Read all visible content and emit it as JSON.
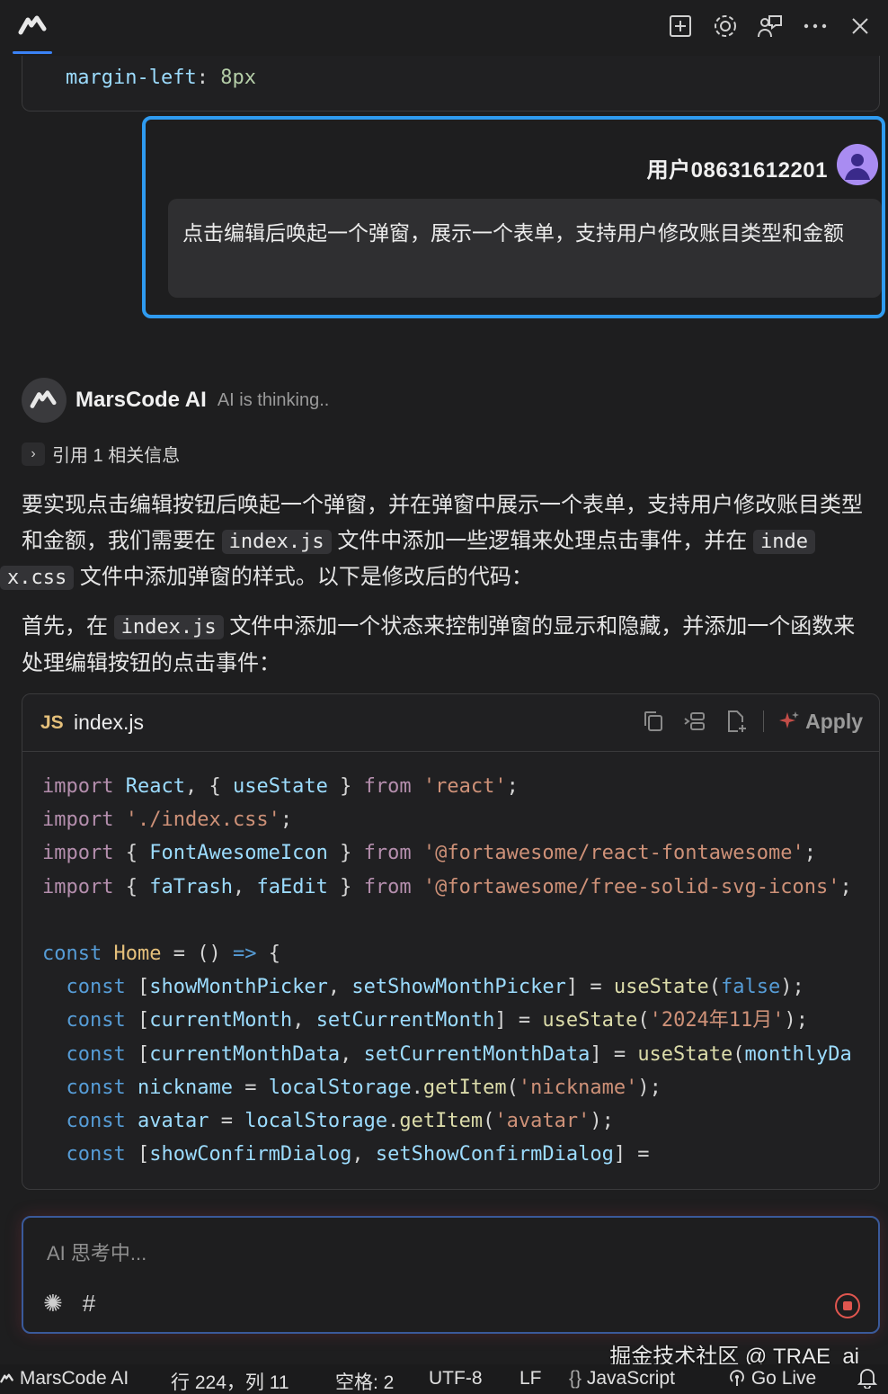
{
  "header": {
    "icons": [
      "new-chat-icon",
      "gear-icon",
      "feedback-icon",
      "more-icon",
      "close-icon"
    ]
  },
  "previous_code": {
    "property": "margin-left",
    "colon": ":",
    "value": "8px"
  },
  "user_message": {
    "username": "用户08631612201",
    "text": "点击编辑后唤起一个弹窗，展示一个表单，支持用户修改账目类型和金额"
  },
  "ai": {
    "name": "MarsCode AI",
    "status": "AI is thinking..",
    "reference": "引用 1 相关信息",
    "para1_a": "要实现点击编辑按钮后唤起一个弹窗，并在弹窗中展示一个表单，支持用户修改账目类型和金额，我们需要在",
    "para1_code1": "index.js",
    "para1_b": "文件中添加一些逻辑来处理点击事件，并在",
    "para1_code2a": "inde",
    "para1_code2b": "x.css",
    "para1_c": "文件中添加弹窗的样式。以下是修改后的代码：",
    "para2_a": "首先，在",
    "para2_code": "index.js",
    "para2_b": "文件中添加一个状态来控制弹窗的显示和隐藏，并添加一个函数来处理编辑按钮的点击事件："
  },
  "code_block": {
    "lang_badge": "JS",
    "file_name": "index.js",
    "apply_label": "Apply",
    "lines": [
      "import React, { useState } from 'react';",
      "import './index.css';",
      "import { FontAwesomeIcon } from '@fortawesome/react-fontawesome';",
      "import { faTrash, faEdit } from '@fortawesome/free-solid-svg-icons';",
      "",
      "const Home = () => {",
      "  const [showMonthPicker, setShowMonthPicker] = useState(false);",
      "  const [currentMonth, setCurrentMonth] = useState('2024年11月');",
      "  const [currentMonthData, setCurrentMonthData] = useState(monthlyDa",
      "  const nickname = localStorage.getItem('nickname');",
      "  const avatar = localStorage.getItem('avatar');",
      "  const [showConfirmDialog, setShowConfirmDialog] ="
    ]
  },
  "input": {
    "placeholder": "AI 思考中..."
  },
  "watermark": "掘金技术社区 @ TRAE_ai",
  "statusbar": {
    "app": "MarsCode AI",
    "position": "行 224，列 11",
    "indent": "空格: 2",
    "encoding": "UTF-8",
    "eol": "LF",
    "language": "JavaScript",
    "golive": "Go Live"
  },
  "colors": {
    "accent": "#2f9bf0",
    "stop": "#e0564f",
    "avatar": "#a98cf2"
  }
}
